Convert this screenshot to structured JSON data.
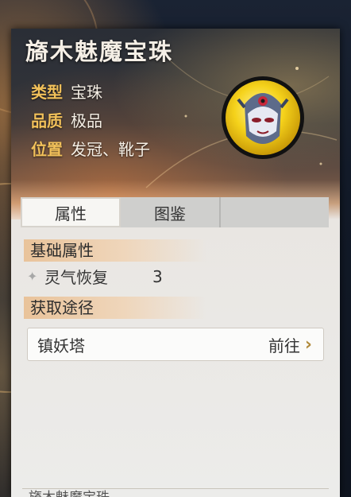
{
  "item": {
    "name": "旖木魅魔宝珠",
    "type_label": "类型",
    "type_value": "宝珠",
    "quality_label": "品质",
    "quality_value": "极品",
    "position_label": "位置",
    "position_value": "发冠、靴子",
    "icon": "demon-mask-gem-icon"
  },
  "tabs": [
    {
      "label": "属性",
      "active": true
    },
    {
      "label": "图鉴",
      "active": false
    }
  ],
  "attributes": {
    "title": "基础属性",
    "items": [
      {
        "name": "灵气恢复",
        "value": "3"
      }
    ]
  },
  "sources": {
    "title": "获取途径",
    "items": [
      {
        "name": "镇妖塔",
        "action": "前往"
      }
    ]
  },
  "description_partial": "旖木魅魔宝珠…",
  "colors": {
    "label_gold": "#f2c15a",
    "section_orange": "#e9c39a",
    "chevron": "#b08a3c"
  }
}
